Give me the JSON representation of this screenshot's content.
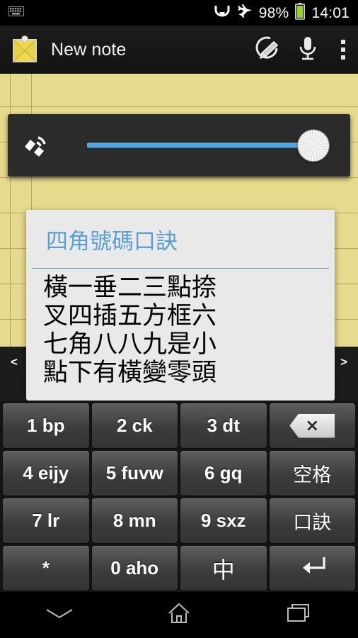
{
  "status_bar": {
    "notification_icon": "keyboard-icon",
    "icons": [
      "bluetooth-headset-icon",
      "airplane-mode-icon"
    ],
    "battery_percent": "98%",
    "battery_icon": "battery-icon",
    "time": "14:01"
  },
  "action_bar": {
    "app_icon": "sticky-note-icon",
    "title": "New note",
    "actions": [
      {
        "name": "draw-icon",
        "label": "Draw"
      },
      {
        "name": "microphone-icon",
        "label": "Voice"
      },
      {
        "name": "overflow-menu-icon",
        "label": "More options"
      }
    ]
  },
  "volume_panel": {
    "icon": "ringer-volume-icon",
    "slider": {
      "value": 100,
      "min": 0,
      "max": 100
    }
  },
  "candidate_bar": {
    "prev_label": "<",
    "next_label": ">"
  },
  "mnemonic_card": {
    "title": "四角號碼口訣",
    "lines": [
      "橫一垂二三點捺",
      "叉四插五方框六",
      "七角八八九是小",
      "點下有橫變零頭"
    ]
  },
  "keyboard": {
    "rows": [
      [
        {
          "name": "key-1-bp",
          "label": "1 bp",
          "type": "text"
        },
        {
          "name": "key-2-ck",
          "label": "2 ck",
          "type": "text"
        },
        {
          "name": "key-3-dt",
          "label": "3 dt",
          "type": "text"
        },
        {
          "name": "key-backspace",
          "label": "⨯",
          "type": "backspace"
        }
      ],
      [
        {
          "name": "key-4-eijy",
          "label": "4 eijy",
          "type": "text"
        },
        {
          "name": "key-5-fuvw",
          "label": "5 fuvw",
          "type": "text"
        },
        {
          "name": "key-6-gq",
          "label": "6 gq",
          "type": "text"
        },
        {
          "name": "key-space",
          "label": "空格",
          "type": "cjk"
        }
      ],
      [
        {
          "name": "key-7-lr",
          "label": "7 lr",
          "type": "text"
        },
        {
          "name": "key-8-mn",
          "label": "8 mn",
          "type": "text"
        },
        {
          "name": "key-9-sxz",
          "label": "9 sxz",
          "type": "text"
        },
        {
          "name": "key-mnemonic",
          "label": "口訣",
          "type": "cjk"
        }
      ],
      [
        {
          "name": "key-star",
          "label": "*",
          "type": "text"
        },
        {
          "name": "key-0-aho",
          "label": "0 aho",
          "type": "text"
        },
        {
          "name": "key-chinese-mode",
          "label": "中",
          "type": "cjk-big"
        },
        {
          "name": "key-enter",
          "label": "↵",
          "type": "enter"
        }
      ]
    ]
  },
  "nav_bar": {
    "buttons": [
      {
        "name": "hide-keyboard-icon",
        "label": "Hide keyboard"
      },
      {
        "name": "home-icon",
        "label": "Home"
      },
      {
        "name": "recents-icon",
        "label": "Recents"
      }
    ]
  },
  "colors": {
    "paper": "#e6da8c",
    "rule_line": "#a79b5c",
    "accent_blue": "#5a9fd4",
    "slider_blue": "#4aa8e8",
    "card_bg": "#e9e9e9",
    "battery_green": "#99cc33"
  }
}
